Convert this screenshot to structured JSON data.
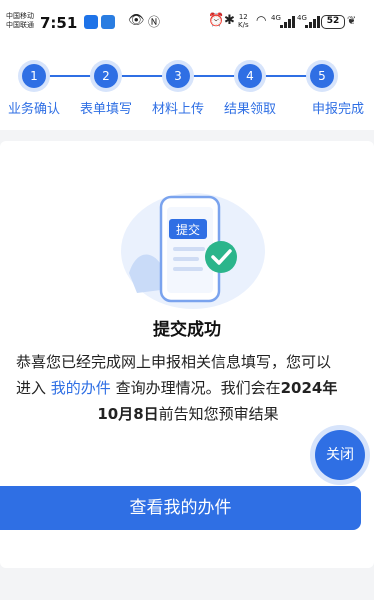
{
  "status_bar": {
    "carrier1": "中国移动",
    "carrier2": "中国联通",
    "time": "7:51",
    "speed_value": "12",
    "speed_unit": "K/s",
    "net1": "4G",
    "net2": "4G",
    "battery": "52"
  },
  "steps": [
    {
      "number": "1",
      "label": "业务确认"
    },
    {
      "number": "2",
      "label": "表单填写"
    },
    {
      "number": "3",
      "label": "材料上传"
    },
    {
      "number": "4",
      "label": "结果领取"
    },
    {
      "number": "5",
      "label": "申报完成"
    }
  ],
  "result": {
    "badge_text": "提交",
    "title": "提交成功",
    "line1": "恭喜您已经完成网上申报相关信息填写，您可以",
    "line2_prefix": "进入 ",
    "line2_link": "我的办件",
    "line2_mid": " 查询办理情况。我们会在",
    "line2_bold": "2024年",
    "line3_bold": "10月8日",
    "line3_suffix": "前告知您预审结果"
  },
  "close_button": "关闭",
  "primary_button": "查看我的办件",
  "colors": {
    "accent": "#2f6fe4",
    "accent_light": "#d7e4fb",
    "success": "#2bb58b"
  }
}
